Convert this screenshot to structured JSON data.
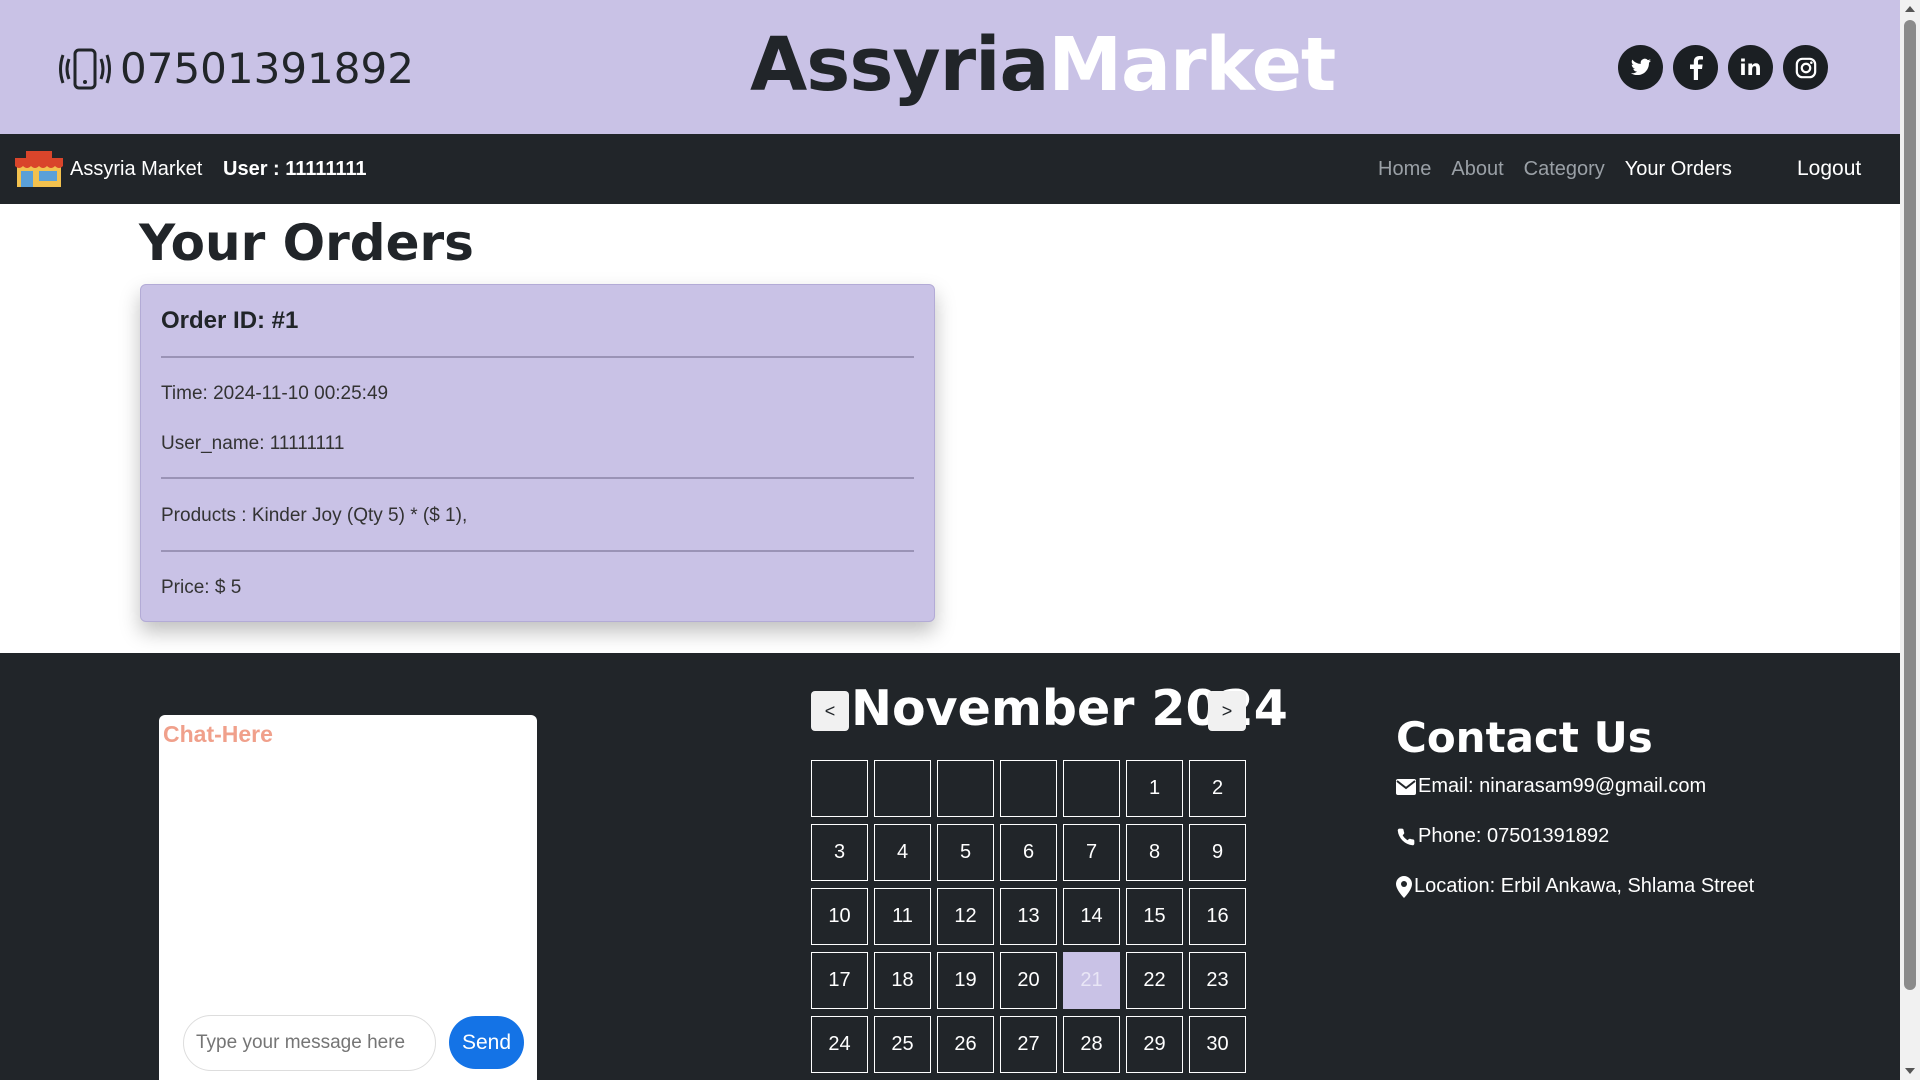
{
  "topbar": {
    "phone_icon": "vibrating-phone-icon",
    "phone": "07501391892",
    "brand_part1": "Assyria",
    "brand_part2": "Market",
    "brand_colors": {
      "dark": "#212529",
      "light": "#ffffff",
      "band": "#c9c2e6"
    },
    "social": [
      {
        "name": "twitter-icon",
        "glyph": "🐦"
      },
      {
        "name": "facebook-icon",
        "glyph": "f"
      },
      {
        "name": "linkedin-icon",
        "glyph": "in"
      },
      {
        "name": "instagram-icon",
        "glyph": "◎"
      }
    ]
  },
  "nav": {
    "logo_icon": "market-store-icon",
    "brand": "Assyria Market",
    "user": "User : 11111111",
    "links": [
      "Home",
      "About",
      "Category",
      "Your Orders"
    ],
    "active": "Your Orders",
    "logout": "Logout"
  },
  "main": {
    "title": "Your Orders",
    "order": {
      "id": "Order ID: #1",
      "time": "Time: 2024-11-10 00:25:49",
      "user_name": "User_name: 11111111",
      "products": "Products : Kinder Joy (Qty 5) * ($ 1),",
      "price": "Price: $ 5"
    }
  },
  "chat": {
    "title": "Chat-Here",
    "placeholder": "Type your message here",
    "send": "Send"
  },
  "calendar": {
    "prev": "<",
    "next": ">",
    "title": "November 2024",
    "leading_blanks": 5,
    "days": [
      "1",
      "2",
      "3",
      "4",
      "5",
      "6",
      "7",
      "8",
      "9",
      "10",
      "11",
      "12",
      "13",
      "14",
      "15",
      "16",
      "17",
      "18",
      "19",
      "20",
      "21",
      "22",
      "23",
      "24",
      "25",
      "26",
      "27",
      "28",
      "29",
      "30"
    ],
    "highlighted": "21",
    "highlight_color": "#c9c2e6"
  },
  "contact": {
    "title": "Contact Us",
    "email": "Email: ninarasam99@gmail.com",
    "phone": "Phone: 07501391892",
    "location": "Location: Erbil Ankawa, Shlama Street"
  }
}
